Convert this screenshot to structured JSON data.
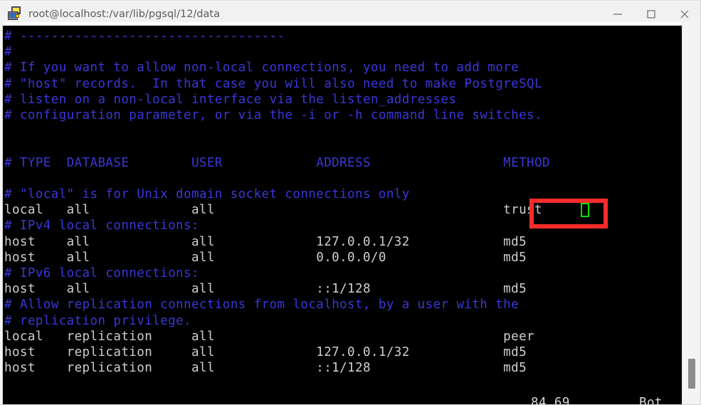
{
  "window": {
    "title": "root@localhost:/var/lib/pgsql/12/data",
    "icon": "terminal-screens-icon",
    "minimize_label": "—",
    "maximize_label": "□",
    "close_label": "✕"
  },
  "terminal": {
    "background": "#000000",
    "comment_color": "#3a37d6",
    "text_color": "#cfcfcf",
    "highlight_box_color": "#fb2c2c",
    "cursor_color": "#00e400",
    "lines": [
      {
        "id": "l01",
        "kind": "comment",
        "text": "# ----------------------------------"
      },
      {
        "id": "l02",
        "kind": "comment",
        "text": "#"
      },
      {
        "id": "l03",
        "kind": "comment",
        "text": "# If you want to allow non-local connections, you need to add more"
      },
      {
        "id": "l04",
        "kind": "comment",
        "text": "# \"host\" records.  In that case you will also need to make PostgreSQL"
      },
      {
        "id": "l05",
        "kind": "comment",
        "text": "# listen on a non-local interface via the listen_addresses"
      },
      {
        "id": "l06",
        "kind": "comment",
        "text": "# configuration parameter, or via the -i or -h command line switches."
      },
      {
        "id": "l07",
        "kind": "comment",
        "text": ""
      },
      {
        "id": "l08",
        "kind": "comment",
        "text": ""
      },
      {
        "id": "l09",
        "kind": "comment",
        "text": "# TYPE  DATABASE        USER            ADDRESS                 METHOD"
      },
      {
        "id": "l10",
        "kind": "comment",
        "text": ""
      },
      {
        "id": "l11",
        "kind": "comment",
        "text": "# \"local\" is for Unix domain socket connections only"
      },
      {
        "id": "l12",
        "kind": "text",
        "text": "local   all             all                                     trust"
      },
      {
        "id": "l13",
        "kind": "comment",
        "text": "# IPv4 local connections:"
      },
      {
        "id": "l14",
        "kind": "text",
        "text": "host    all             all             127.0.0.1/32            md5"
      },
      {
        "id": "l15",
        "kind": "text",
        "text": "host    all             all             0.0.0.0/0               md5"
      },
      {
        "id": "l16",
        "kind": "comment",
        "text": "# IPv6 local connections:"
      },
      {
        "id": "l17",
        "kind": "text",
        "text": "host    all             all             ::1/128                 md5"
      },
      {
        "id": "l18",
        "kind": "comment",
        "text": "# Allow replication connections from localhost, by a user with the"
      },
      {
        "id": "l19",
        "kind": "comment",
        "text": "# replication privilege."
      },
      {
        "id": "l20",
        "kind": "text",
        "text": "local   replication     all                                     peer"
      },
      {
        "id": "l21",
        "kind": "text",
        "text": "host    replication     all             127.0.0.1/32            md5"
      },
      {
        "id": "l22",
        "kind": "text",
        "text": "host    replication     all             ::1/128                 md5"
      }
    ],
    "status_line": {
      "position": "84,69",
      "scroll_state": "Bot"
    },
    "hba_table": {
      "headers": [
        "# TYPE",
        "DATABASE",
        "USER",
        "ADDRESS",
        "METHOD"
      ],
      "rows": [
        {
          "type": "local",
          "database": "all",
          "user": "all",
          "address": "",
          "method": "trust",
          "highlighted": true
        },
        {
          "type": "host",
          "database": "all",
          "user": "all",
          "address": "127.0.0.1/32",
          "method": "md5",
          "highlighted": false
        },
        {
          "type": "host",
          "database": "all",
          "user": "all",
          "address": "0.0.0.0/0",
          "method": "md5",
          "highlighted": false
        },
        {
          "type": "host",
          "database": "all",
          "user": "all",
          "address": "::1/128",
          "method": "md5",
          "highlighted": false
        },
        {
          "type": "local",
          "database": "replication",
          "user": "all",
          "address": "",
          "method": "peer",
          "highlighted": false
        },
        {
          "type": "host",
          "database": "replication",
          "user": "all",
          "address": "127.0.0.1/32",
          "method": "md5",
          "highlighted": false
        },
        {
          "type": "host",
          "database": "replication",
          "user": "all",
          "address": "::1/128",
          "method": "md5",
          "highlighted": false
        }
      ]
    }
  }
}
